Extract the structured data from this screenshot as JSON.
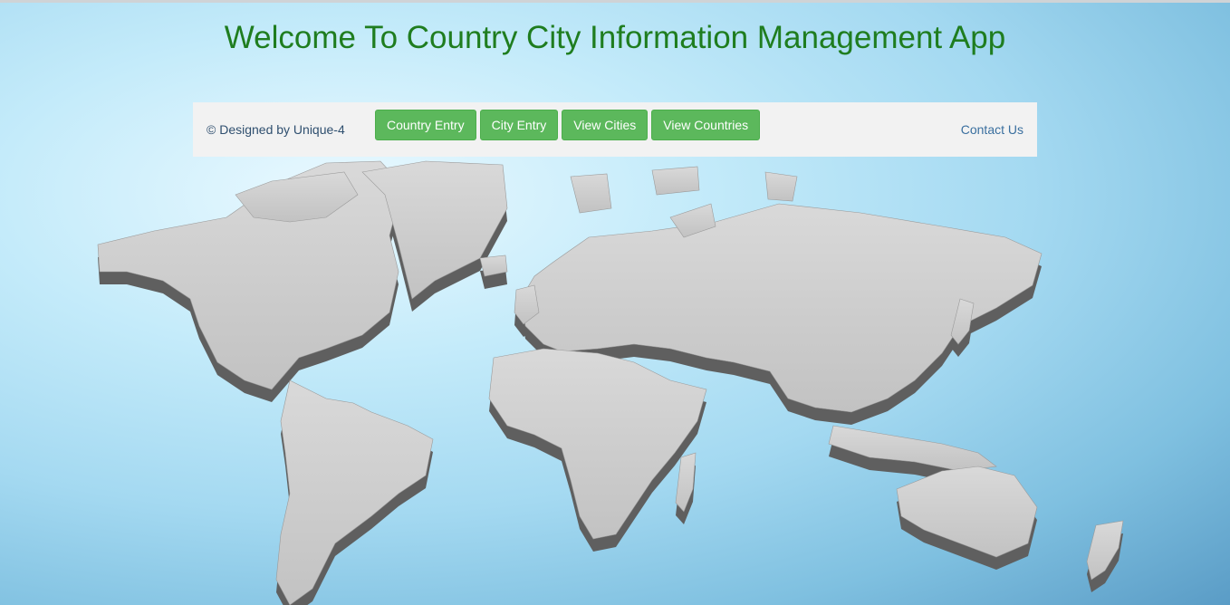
{
  "header": {
    "title": "Welcome To Country City Information Management App"
  },
  "navbar": {
    "brand": "© Designed by Unique-4",
    "buttons": [
      {
        "label": "Country Entry"
      },
      {
        "label": "City Entry"
      },
      {
        "label": "View Cities"
      },
      {
        "label": "View Countries"
      }
    ],
    "contact": "Contact Us"
  },
  "colors": {
    "title": "#1f7d1f",
    "button_bg": "#5cb85c",
    "navbar_bg": "#f2f2f2",
    "link": "#3a6f9f"
  },
  "background": {
    "icon": "world-map-3d-icon"
  }
}
